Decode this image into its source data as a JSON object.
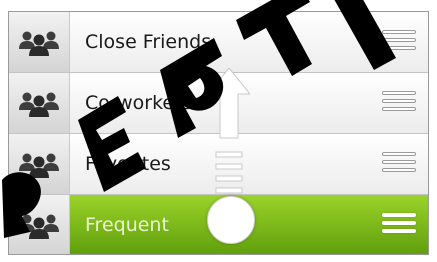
{
  "groups": [
    {
      "label": "Close Friends",
      "selected": false
    },
    {
      "label": "Co-workers",
      "selected": false
    },
    {
      "label": "Favorites",
      "selected": false
    },
    {
      "label": "Frequent",
      "selected": true
    }
  ],
  "icons": {
    "avatar": "people-group-icon",
    "grip": "drag-handle-icon",
    "drag": "drag-up-arrow-icon"
  },
  "colors": {
    "selected_top": "#9bd32a",
    "selected_bottom": "#5f9e0c",
    "avatar_fill": "#3d3d3d",
    "watermark": "#000000"
  }
}
